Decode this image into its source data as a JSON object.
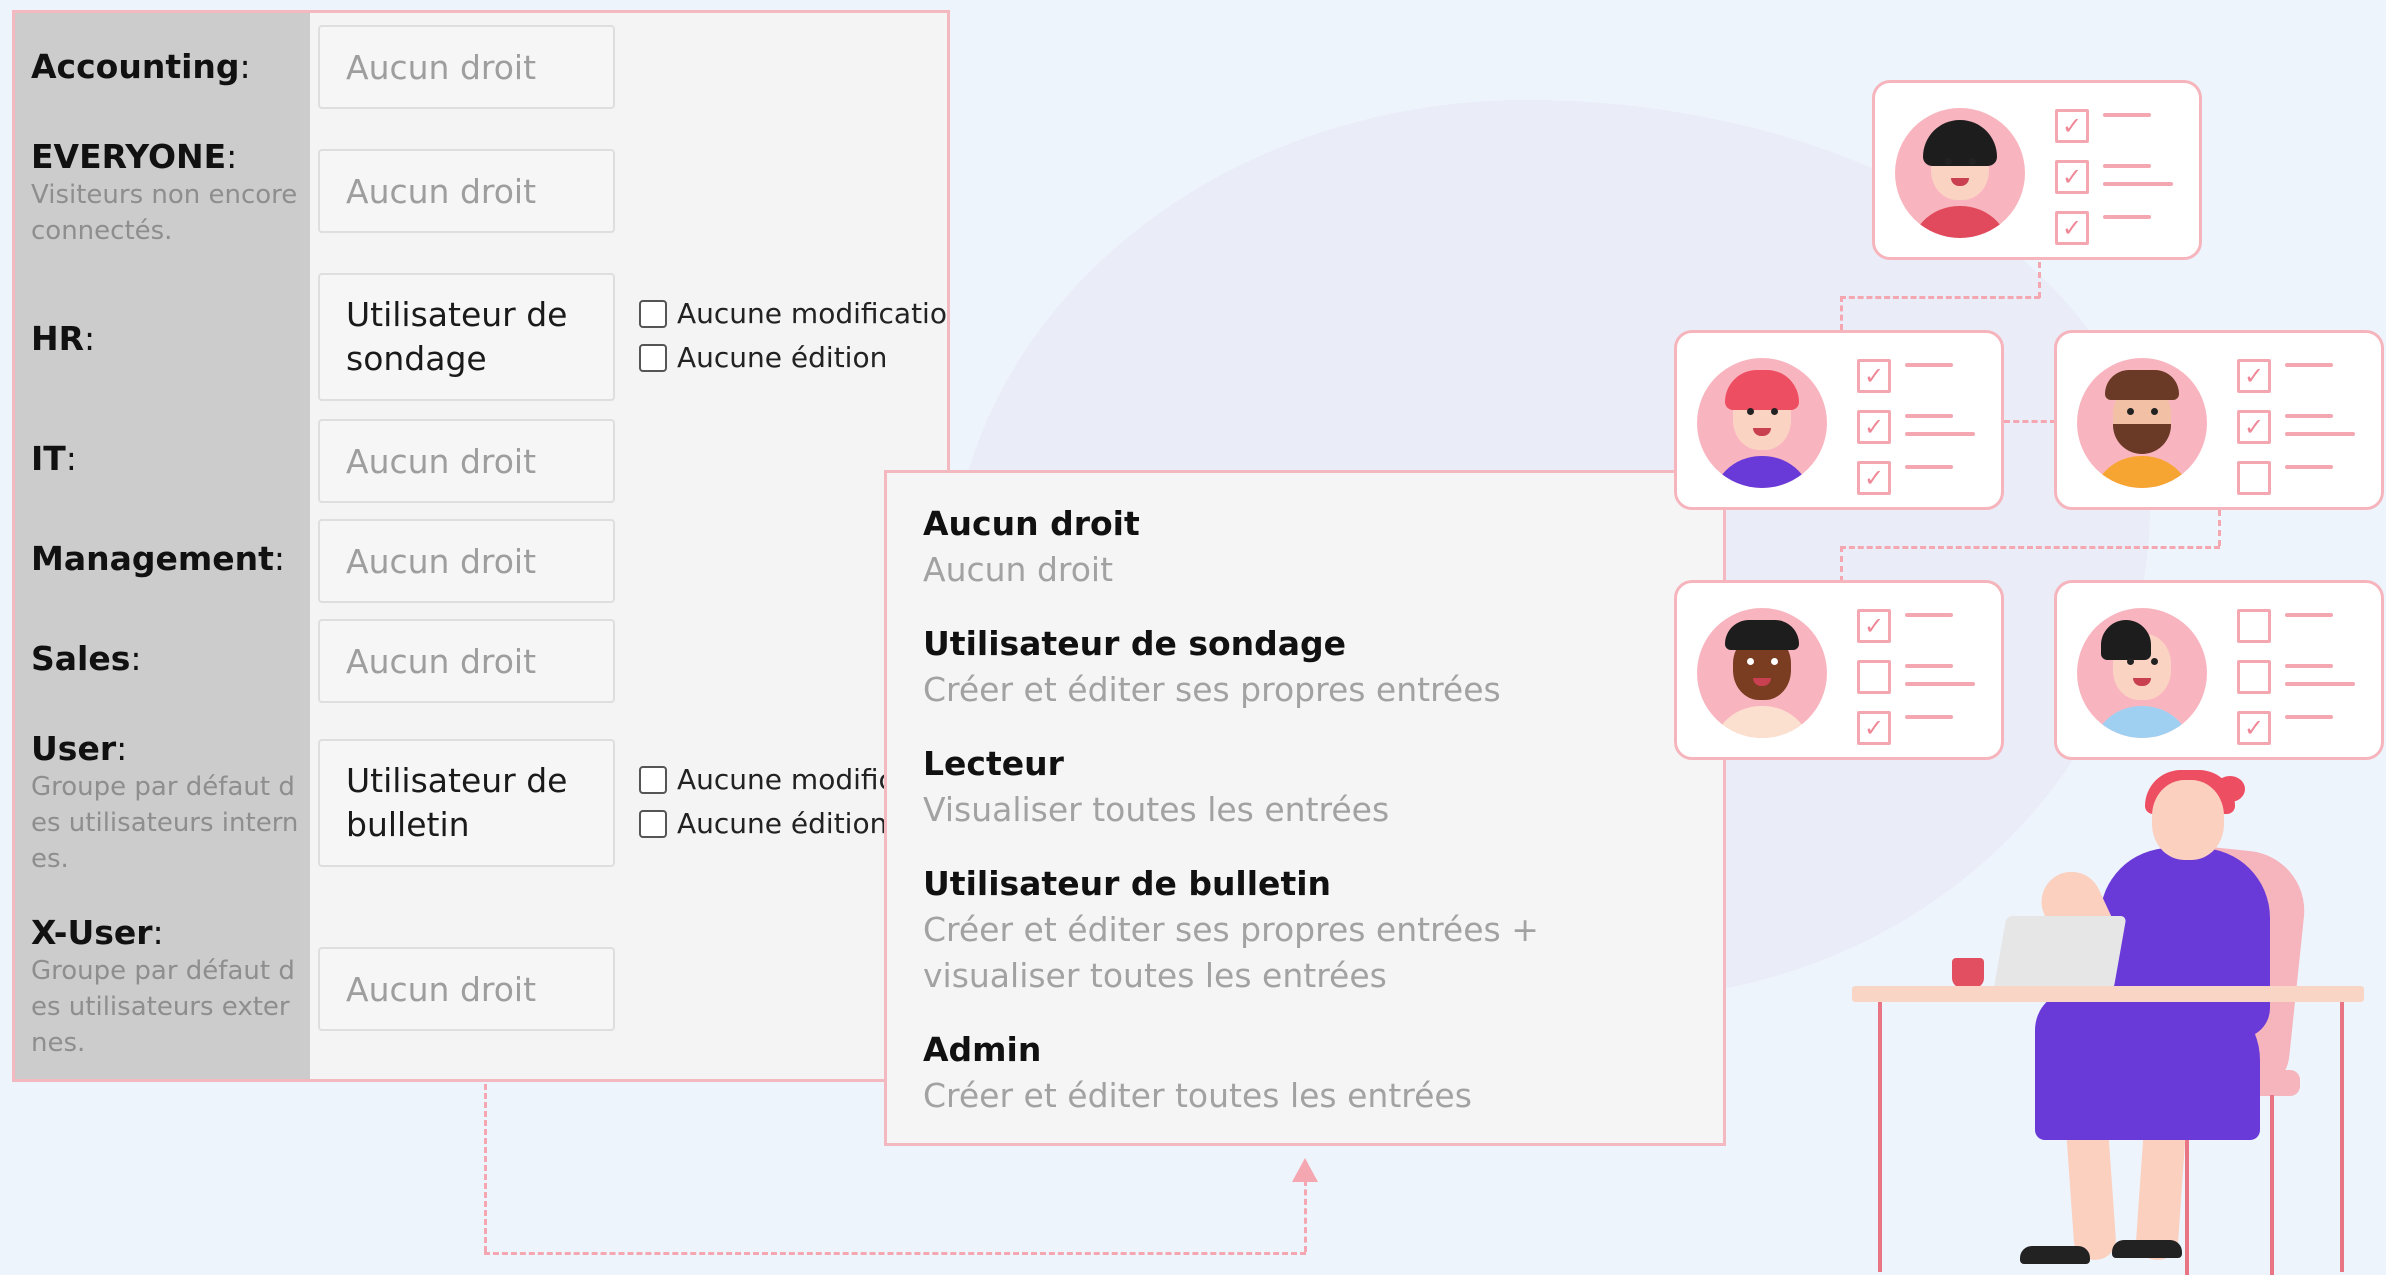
{
  "permissions_panel": {
    "groups": [
      {
        "name": "Accounting",
        "description": "",
        "selected": "Aucun droit",
        "checkboxes": []
      },
      {
        "name": "EVERYONE",
        "description": "Visiteurs non encore connectés.",
        "selected": "Aucun droit",
        "checkboxes": []
      },
      {
        "name": "HR",
        "description": "",
        "selected": "Utilisateur de sondage",
        "checkboxes": [
          "Aucune modification",
          "Aucune édition"
        ]
      },
      {
        "name": "IT",
        "description": "",
        "selected": "Aucun droit",
        "checkboxes": []
      },
      {
        "name": "Management",
        "description": "",
        "selected": "Aucun droit",
        "checkboxes": []
      },
      {
        "name": "Sales",
        "description": "",
        "selected": "Aucun droit",
        "checkboxes": []
      },
      {
        "name": "User",
        "description": "Groupe par défaut des utilisateurs internes.",
        "selected": "Utilisateur de bulletin",
        "checkboxes": [
          "Aucune modification",
          "Aucune édition"
        ]
      },
      {
        "name": "X-User",
        "description": "Groupe par défaut des utilisateurs externes.",
        "selected": "Aucun droit",
        "checkboxes": []
      }
    ]
  },
  "dropdown": {
    "options": [
      {
        "title": "Aucun droit",
        "description": "Aucun droit"
      },
      {
        "title": "Utilisateur de sondage",
        "description": "Créer et éditer ses propres entrées"
      },
      {
        "title": "Lecteur",
        "description": "Visualiser toutes les entrées"
      },
      {
        "title": "Utilisateur de bulletin",
        "description": "Créer et éditer ses propres entrées + visualiser toutes les entrées"
      },
      {
        "title": "Admin",
        "description": "Créer et éditer toutes les entrées"
      }
    ]
  },
  "org_chart": {
    "accent_color": "#f4a7b0",
    "cards": [
      {
        "avatar": "woman-black-hair-avatar",
        "checks": [
          true,
          true,
          true
        ]
      },
      {
        "avatar": "woman-red-hair-avatar",
        "checks": [
          true,
          true,
          true
        ]
      },
      {
        "avatar": "bearded-man-avatar",
        "checks": [
          true,
          true,
          false
        ]
      },
      {
        "avatar": "man-dark-skin-avatar",
        "checks": [
          true,
          false,
          true
        ]
      },
      {
        "avatar": "woman-ponytail-avatar",
        "checks": [
          false,
          false,
          true
        ]
      }
    ]
  }
}
